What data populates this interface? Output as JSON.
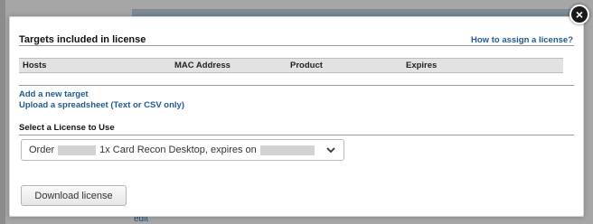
{
  "background": {
    "edit_link": "edit"
  },
  "modal": {
    "close_symbol": "×",
    "section_title": "Targets included in license",
    "help_link": "How to assign a license?",
    "table": {
      "columns": [
        "Hosts",
        "MAC Address",
        "Product",
        "Expires"
      ],
      "rows": []
    },
    "add_target_link": "Add a new target",
    "upload_link": "Upload a spreadsheet (Text or CSV only)",
    "select_label": "Select a License to Use",
    "license_select": {
      "prefix": "Order",
      "middle": "1x Card Recon Desktop, expires on",
      "icon": "chevron-down-icon"
    },
    "download_button": "Download license"
  },
  "colors": {
    "link": "#1e5b8f",
    "overlay": "#8c8c8c",
    "table_header_bg": "#e2e2e2"
  }
}
